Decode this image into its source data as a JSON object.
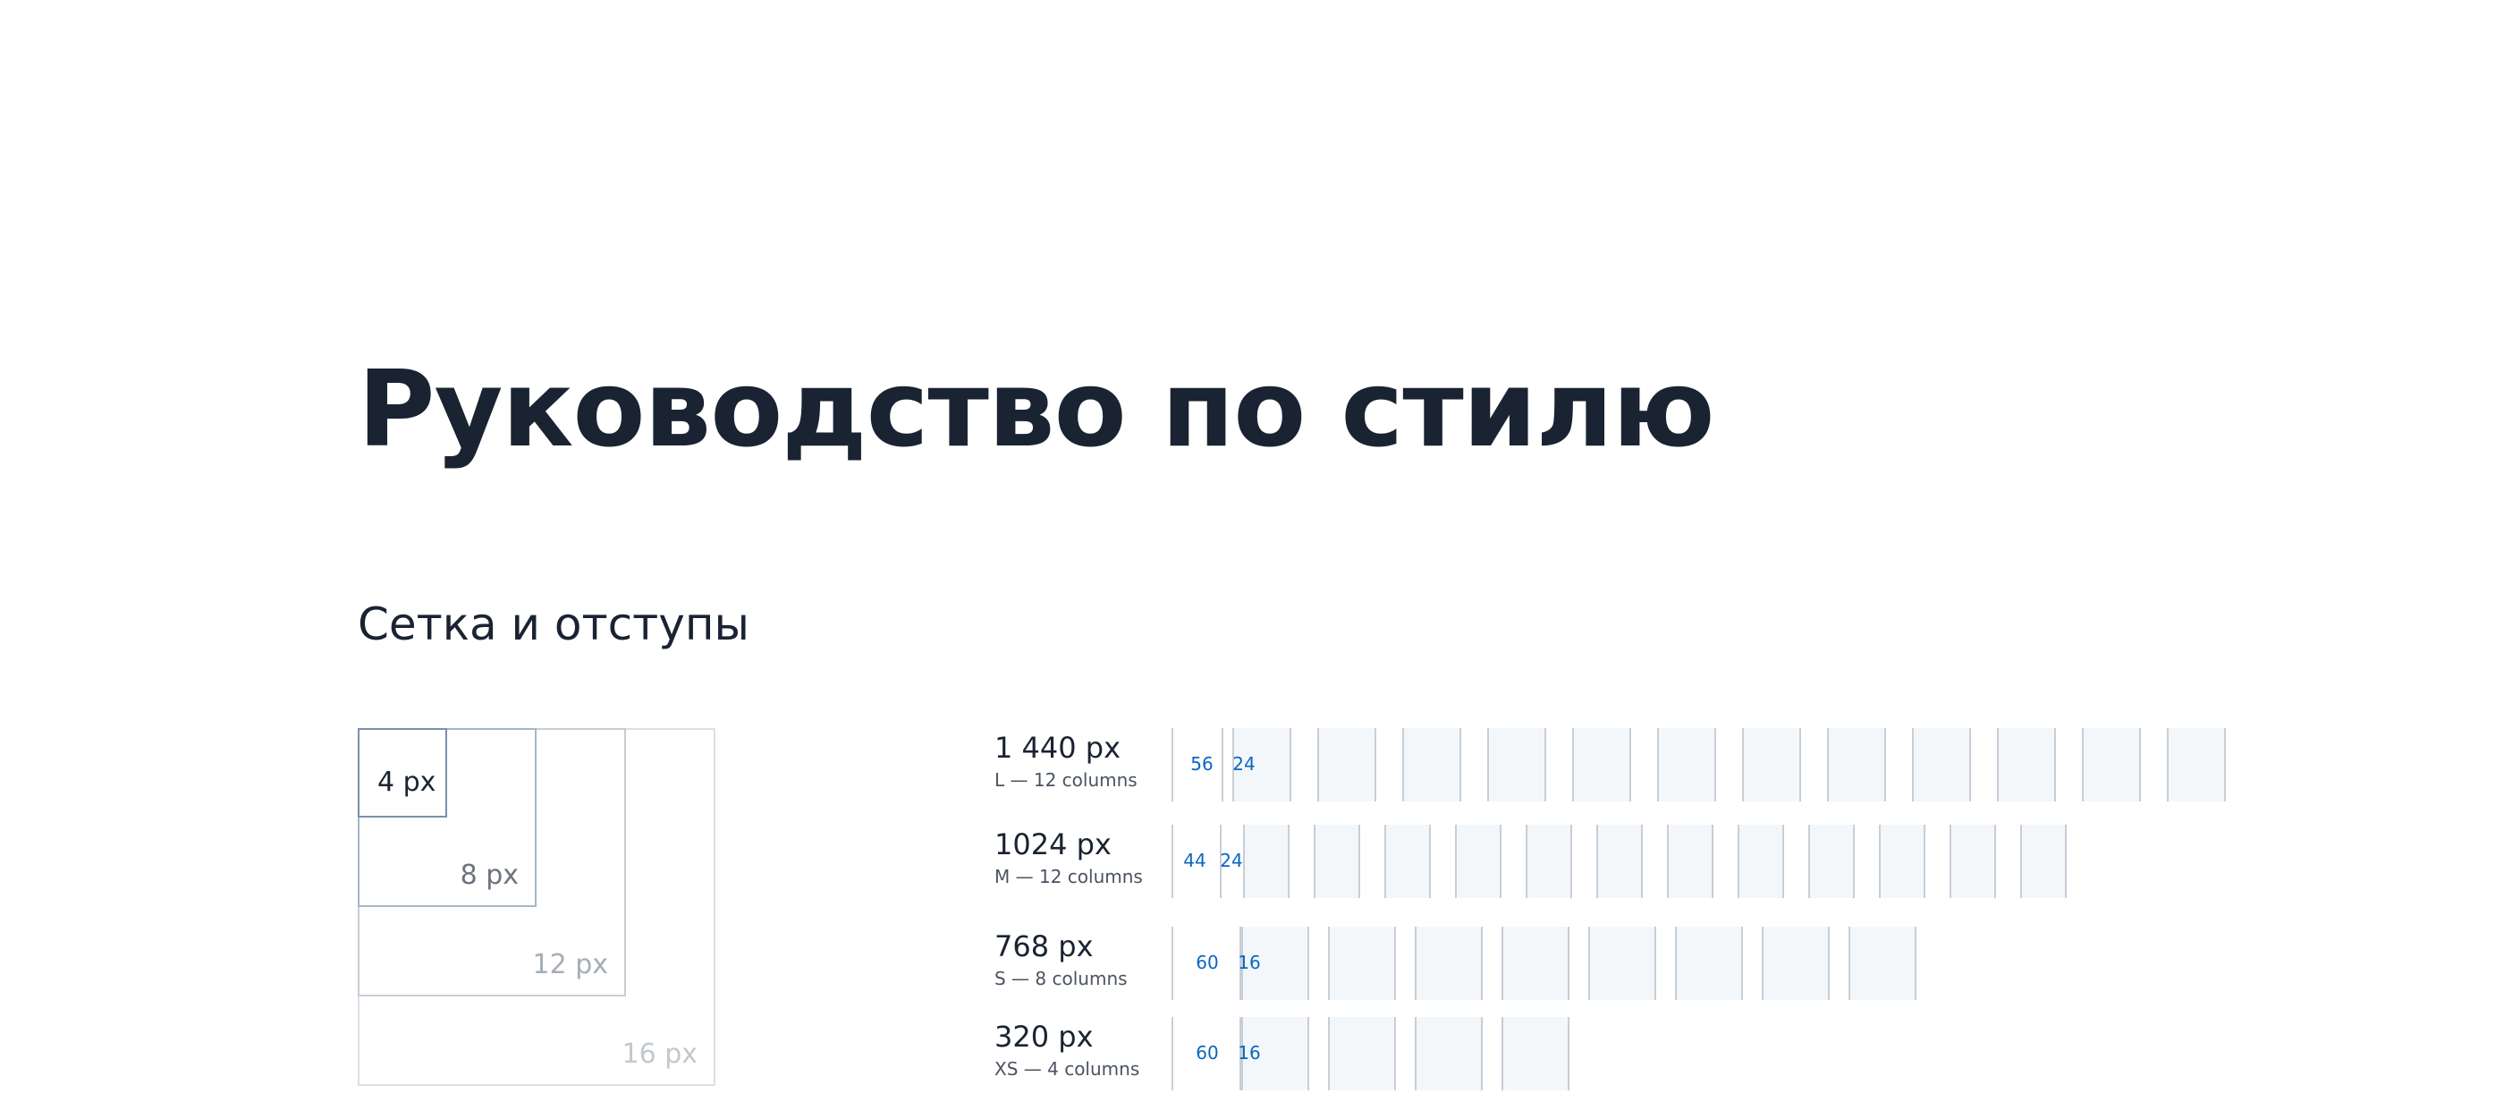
{
  "page": {
    "title": "Руководство по стилю"
  },
  "section": {
    "title": "Сетка и отступы"
  },
  "spacing": [
    {
      "label": "16 px"
    },
    {
      "label": "12 px"
    },
    {
      "label": "8 px"
    },
    {
      "label": "4 px"
    }
  ],
  "breakpoints": [
    {
      "name": "1 440  px",
      "description": "L — 12 columns",
      "margin_label": "56",
      "gutter_label": "24",
      "columns": 12
    },
    {
      "name": "1024 px",
      "description": "M — 12 columns",
      "margin_label": "44",
      "gutter_label": "24",
      "columns": 12
    },
    {
      "name": "768 px",
      "description": "S — 8 columns",
      "margin_label": "60",
      "gutter_label": "16",
      "columns": 8
    },
    {
      "name": "320 px",
      "description": "XS — 4 columns",
      "margin_label": "60",
      "gutter_label": "16",
      "columns": 4
    }
  ],
  "colors": {
    "text": "#1a2332",
    "accent": "#0a66c2",
    "column_fill": "#f4f7fa",
    "column_border": "#c8ced7"
  }
}
